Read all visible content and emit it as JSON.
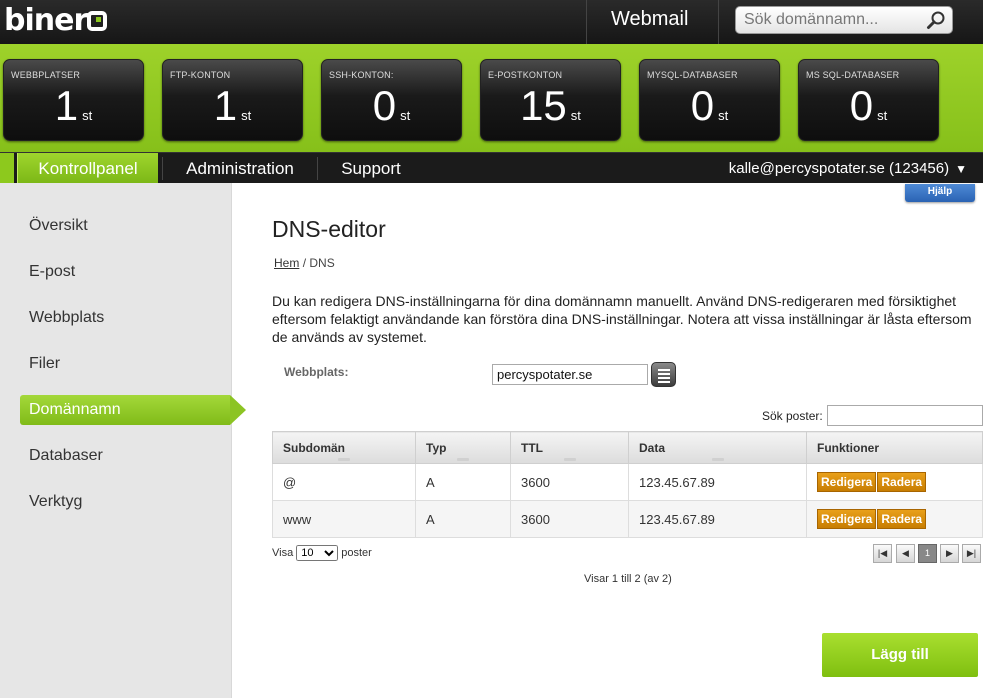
{
  "header": {
    "logo": "binero",
    "webmail": "Webmail",
    "search_placeholder": "Sök domännamn..."
  },
  "stats": [
    {
      "label": "WEBBPLATSER",
      "value": "1",
      "unit": "st"
    },
    {
      "label": "FTP-KONTON",
      "value": "1",
      "unit": "st"
    },
    {
      "label": "SSH-KONTON:",
      "value": "0",
      "unit": "st"
    },
    {
      "label": "E-POSTKONTON",
      "value": "15",
      "unit": "st"
    },
    {
      "label": "MYSQL-DATABASER",
      "value": "0",
      "unit": "st"
    },
    {
      "label": "MS SQL-DATABASER",
      "value": "0",
      "unit": "st"
    }
  ],
  "nav": {
    "items": [
      "Kontrollpanel",
      "Administration",
      "Support"
    ],
    "active": "Kontrollpanel",
    "account": "kalle@percyspotater.se (123456)"
  },
  "sidebar": {
    "items": [
      "Översikt",
      "E-post",
      "Webbplats",
      "Filer",
      "Domännamn",
      "Databaser",
      "Verktyg"
    ],
    "active": "Domännamn"
  },
  "help": "Hjälp",
  "main": {
    "title": "DNS-editor",
    "breadcrumb": {
      "home": "Hem",
      "sep": "/",
      "current": "DNS"
    },
    "intro": "Du kan redigera DNS-inställningarna för dina domännamn manuellt. Använd DNS-redigeraren med försiktighet eftersom felaktigt användande kan förstöra dina DNS-inställningar. Notera att vissa inställningar är låsta eftersom de används av systemet.",
    "site_label": "Webbplats:",
    "site_value": "percyspotater.se",
    "search_posts_label": "Sök poster:"
  },
  "table": {
    "columns": [
      "Subdomän",
      "Typ",
      "TTL",
      "Data",
      "Funktioner"
    ],
    "rows": [
      {
        "subdomain": "@",
        "type": "A",
        "ttl": "3600",
        "data": "123.45.67.89"
      },
      {
        "subdomain": "www",
        "type": "A",
        "ttl": "3600",
        "data": "123.45.67.89"
      }
    ],
    "edit_label": "Redigera",
    "delete_label": "Radera"
  },
  "paging": {
    "show_label": "Visa",
    "show_value": "10",
    "posts_label": "poster",
    "info": "Visar 1 till 2 (av 2)",
    "current_page": "1"
  },
  "add_button": "Lägg till",
  "colors": {
    "accent": "#8dc91d",
    "button": "#d9890a",
    "help": "#2f6cc0"
  }
}
